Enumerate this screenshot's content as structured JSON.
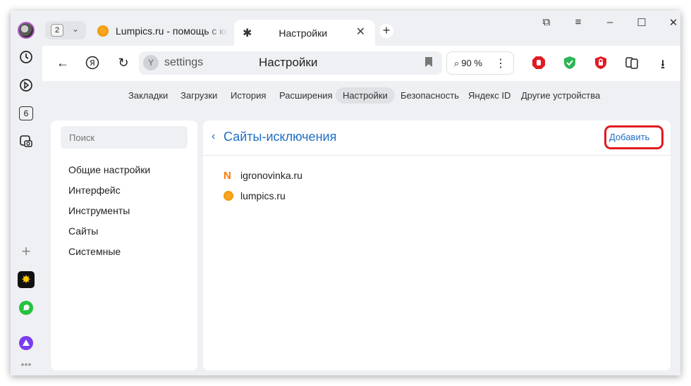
{
  "tabstrip": {
    "tab_count": "2",
    "tabs": [
      {
        "title": "Lumpics.ru - помощь с компьютером"
      },
      {
        "title": "Настройки"
      }
    ]
  },
  "side_panel": {
    "tabs_badge": "6"
  },
  "toolbar": {
    "url": "settings",
    "page_title": "Настройки",
    "zoom": "90 %"
  },
  "settings_nav": {
    "items": [
      {
        "label": "Закладки"
      },
      {
        "label": "Загрузки"
      },
      {
        "label": "История"
      },
      {
        "label": "Расширения"
      },
      {
        "label": "Настройки"
      },
      {
        "label": "Безопасность"
      },
      {
        "label": "Яндекс ID"
      },
      {
        "label": "Другие устройства"
      }
    ],
    "active": "Настройки"
  },
  "sidebar": {
    "search_placeholder": "Поиск",
    "items": [
      {
        "label": "Общие настройки"
      },
      {
        "label": "Интерфейс"
      },
      {
        "label": "Инструменты"
      },
      {
        "label": "Сайты"
      },
      {
        "label": "Системные"
      }
    ]
  },
  "content": {
    "title": "Сайты-исключения",
    "add_label": "Добавить",
    "sites": [
      {
        "domain": "igronovinka.ru",
        "icon": "n-letter-icon"
      },
      {
        "domain": "lumpics.ru",
        "icon": "orange-icon"
      }
    ]
  },
  "colors": {
    "accent": "#1f6fc4",
    "highlight": "#e11b22",
    "bg": "#eef0f3"
  }
}
